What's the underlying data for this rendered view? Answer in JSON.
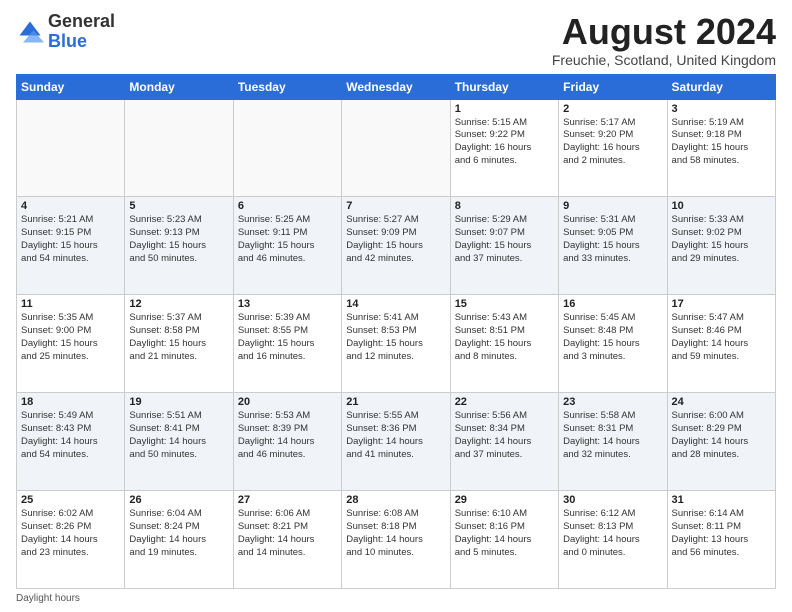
{
  "logo": {
    "general": "General",
    "blue": "Blue"
  },
  "header": {
    "title": "August 2024",
    "subtitle": "Freuchie, Scotland, United Kingdom"
  },
  "days_of_week": [
    "Sunday",
    "Monday",
    "Tuesday",
    "Wednesday",
    "Thursday",
    "Friday",
    "Saturday"
  ],
  "weeks": [
    [
      {
        "day": "",
        "info": ""
      },
      {
        "day": "",
        "info": ""
      },
      {
        "day": "",
        "info": ""
      },
      {
        "day": "",
        "info": ""
      },
      {
        "day": "1",
        "info": "Sunrise: 5:15 AM\nSunset: 9:22 PM\nDaylight: 16 hours\nand 6 minutes."
      },
      {
        "day": "2",
        "info": "Sunrise: 5:17 AM\nSunset: 9:20 PM\nDaylight: 16 hours\nand 2 minutes."
      },
      {
        "day": "3",
        "info": "Sunrise: 5:19 AM\nSunset: 9:18 PM\nDaylight: 15 hours\nand 58 minutes."
      }
    ],
    [
      {
        "day": "4",
        "info": "Sunrise: 5:21 AM\nSunset: 9:15 PM\nDaylight: 15 hours\nand 54 minutes."
      },
      {
        "day": "5",
        "info": "Sunrise: 5:23 AM\nSunset: 9:13 PM\nDaylight: 15 hours\nand 50 minutes."
      },
      {
        "day": "6",
        "info": "Sunrise: 5:25 AM\nSunset: 9:11 PM\nDaylight: 15 hours\nand 46 minutes."
      },
      {
        "day": "7",
        "info": "Sunrise: 5:27 AM\nSunset: 9:09 PM\nDaylight: 15 hours\nand 42 minutes."
      },
      {
        "day": "8",
        "info": "Sunrise: 5:29 AM\nSunset: 9:07 PM\nDaylight: 15 hours\nand 37 minutes."
      },
      {
        "day": "9",
        "info": "Sunrise: 5:31 AM\nSunset: 9:05 PM\nDaylight: 15 hours\nand 33 minutes."
      },
      {
        "day": "10",
        "info": "Sunrise: 5:33 AM\nSunset: 9:02 PM\nDaylight: 15 hours\nand 29 minutes."
      }
    ],
    [
      {
        "day": "11",
        "info": "Sunrise: 5:35 AM\nSunset: 9:00 PM\nDaylight: 15 hours\nand 25 minutes."
      },
      {
        "day": "12",
        "info": "Sunrise: 5:37 AM\nSunset: 8:58 PM\nDaylight: 15 hours\nand 21 minutes."
      },
      {
        "day": "13",
        "info": "Sunrise: 5:39 AM\nSunset: 8:55 PM\nDaylight: 15 hours\nand 16 minutes."
      },
      {
        "day": "14",
        "info": "Sunrise: 5:41 AM\nSunset: 8:53 PM\nDaylight: 15 hours\nand 12 minutes."
      },
      {
        "day": "15",
        "info": "Sunrise: 5:43 AM\nSunset: 8:51 PM\nDaylight: 15 hours\nand 8 minutes."
      },
      {
        "day": "16",
        "info": "Sunrise: 5:45 AM\nSunset: 8:48 PM\nDaylight: 15 hours\nand 3 minutes."
      },
      {
        "day": "17",
        "info": "Sunrise: 5:47 AM\nSunset: 8:46 PM\nDaylight: 14 hours\nand 59 minutes."
      }
    ],
    [
      {
        "day": "18",
        "info": "Sunrise: 5:49 AM\nSunset: 8:43 PM\nDaylight: 14 hours\nand 54 minutes."
      },
      {
        "day": "19",
        "info": "Sunrise: 5:51 AM\nSunset: 8:41 PM\nDaylight: 14 hours\nand 50 minutes."
      },
      {
        "day": "20",
        "info": "Sunrise: 5:53 AM\nSunset: 8:39 PM\nDaylight: 14 hours\nand 46 minutes."
      },
      {
        "day": "21",
        "info": "Sunrise: 5:55 AM\nSunset: 8:36 PM\nDaylight: 14 hours\nand 41 minutes."
      },
      {
        "day": "22",
        "info": "Sunrise: 5:56 AM\nSunset: 8:34 PM\nDaylight: 14 hours\nand 37 minutes."
      },
      {
        "day": "23",
        "info": "Sunrise: 5:58 AM\nSunset: 8:31 PM\nDaylight: 14 hours\nand 32 minutes."
      },
      {
        "day": "24",
        "info": "Sunrise: 6:00 AM\nSunset: 8:29 PM\nDaylight: 14 hours\nand 28 minutes."
      }
    ],
    [
      {
        "day": "25",
        "info": "Sunrise: 6:02 AM\nSunset: 8:26 PM\nDaylight: 14 hours\nand 23 minutes."
      },
      {
        "day": "26",
        "info": "Sunrise: 6:04 AM\nSunset: 8:24 PM\nDaylight: 14 hours\nand 19 minutes."
      },
      {
        "day": "27",
        "info": "Sunrise: 6:06 AM\nSunset: 8:21 PM\nDaylight: 14 hours\nand 14 minutes."
      },
      {
        "day": "28",
        "info": "Sunrise: 6:08 AM\nSunset: 8:18 PM\nDaylight: 14 hours\nand 10 minutes."
      },
      {
        "day": "29",
        "info": "Sunrise: 6:10 AM\nSunset: 8:16 PM\nDaylight: 14 hours\nand 5 minutes."
      },
      {
        "day": "30",
        "info": "Sunrise: 6:12 AM\nSunset: 8:13 PM\nDaylight: 14 hours\nand 0 minutes."
      },
      {
        "day": "31",
        "info": "Sunrise: 6:14 AM\nSunset: 8:11 PM\nDaylight: 13 hours\nand 56 minutes."
      }
    ]
  ],
  "footer": {
    "daylight_label": "Daylight hours"
  }
}
